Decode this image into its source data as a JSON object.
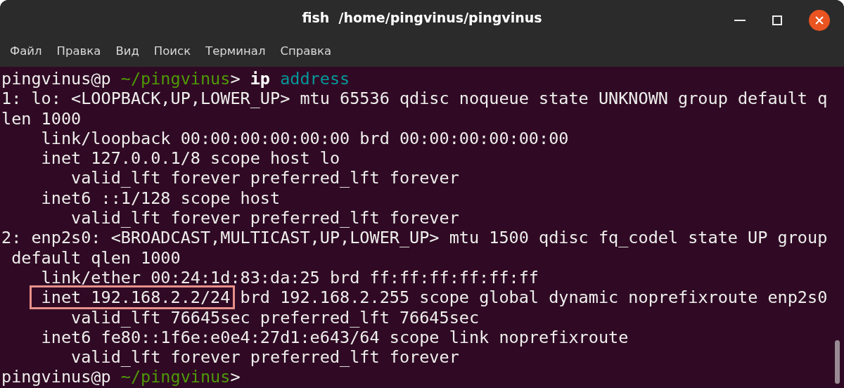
{
  "window": {
    "title": "fish  /home/pingvinus/pingvinus"
  },
  "menu": [
    "Файл",
    "Правка",
    "Вид",
    "Поиск",
    "Терминал",
    "Справка"
  ],
  "terminal": {
    "lines": [
      [
        {
          "text": "pingvinus@p ",
          "kind": "prompt"
        },
        {
          "text": "~/pingvinus",
          "kind": "path"
        },
        {
          "text": "> ",
          "kind": "prompt"
        },
        {
          "text": "ip ",
          "kind": "command"
        },
        {
          "text": "address",
          "kind": "argument"
        }
      ],
      [
        {
          "text": "1: lo: <LOOPBACK,UP,LOWER_UP> mtu 65536 qdisc noqueue state UNKNOWN group default q",
          "kind": "output"
        }
      ],
      [
        {
          "text": "len 1000",
          "kind": "output"
        }
      ],
      [
        {
          "text": "    link/loopback 00:00:00:00:00:00 brd 00:00:00:00:00:00",
          "kind": "output"
        }
      ],
      [
        {
          "text": "    inet 127.0.0.1/8 scope host lo",
          "kind": "output"
        }
      ],
      [
        {
          "text": "       valid_lft forever preferred_lft forever",
          "kind": "output"
        }
      ],
      [
        {
          "text": "    inet6 ::1/128 scope host",
          "kind": "output"
        }
      ],
      [
        {
          "text": "       valid_lft forever preferred_lft forever",
          "kind": "output"
        }
      ],
      [
        {
          "text": "2: enp2s0: <BROADCAST,MULTICAST,UP,LOWER_UP> mtu 1500 qdisc fq_codel state UP group",
          "kind": "output"
        }
      ],
      [
        {
          "text": " default qlen 1000",
          "kind": "output"
        }
      ],
      [
        {
          "text": "    link/ether 00:24:1d:83:da:25 brd ff:ff:ff:ff:ff:ff",
          "kind": "output"
        }
      ],
      [
        {
          "text": "    inet 192.168.2.2/24",
          "kind": "output",
          "highlighted": true
        },
        {
          "text": " brd 192.168.2.255 scope global dynamic noprefixroute enp2s0",
          "kind": "output"
        }
      ],
      [
        {
          "text": "       valid_lft 76645sec preferred_lft 76645sec",
          "kind": "output"
        }
      ],
      [
        {
          "text": "    inet6 fe80::1f6e:e0e4:27d1:e643/64 scope link noprefixroute",
          "kind": "output"
        }
      ],
      [
        {
          "text": "       valid_lft forever preferred_lft forever",
          "kind": "output"
        }
      ],
      [
        {
          "text": "pingvinus@p ",
          "kind": "prompt"
        },
        {
          "text": "~/pingvinus",
          "kind": "path"
        },
        {
          "text": ">",
          "kind": "prompt"
        }
      ]
    ]
  }
}
